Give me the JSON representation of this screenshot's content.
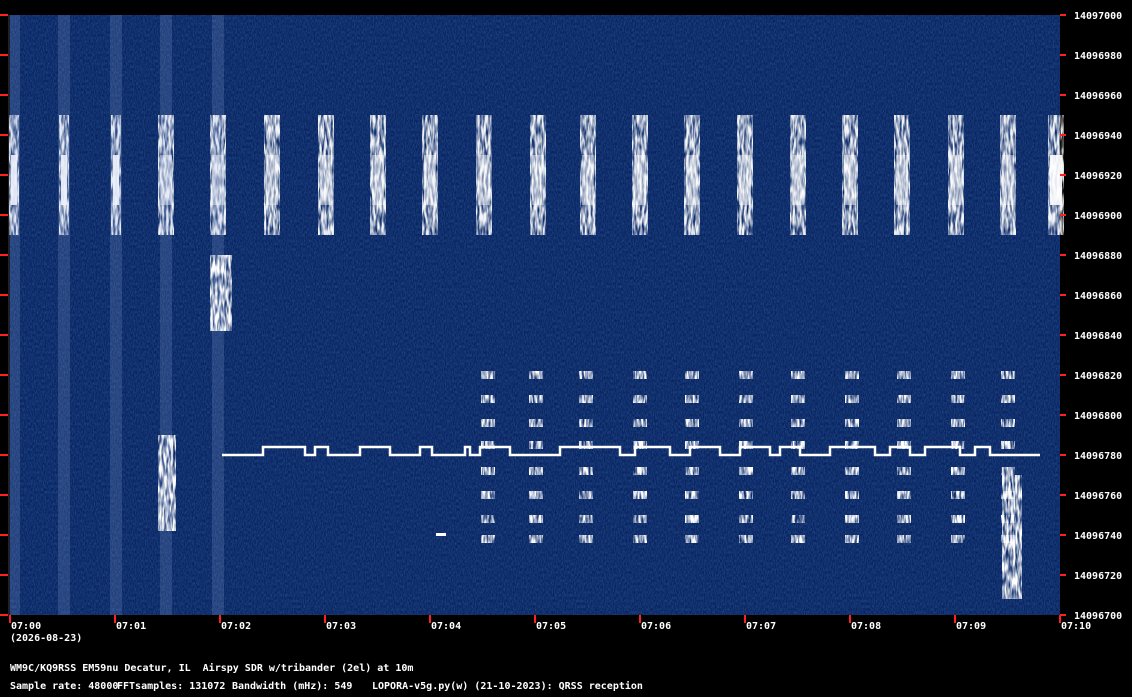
{
  "chart_data": {
    "type": "heatmap",
    "title": "WM9C/KQ9RSS EM59nu Decatur, IL  Airspy SDR w/tribander (2el) at 10m",
    "date": "(2026-08-23)",
    "x_tick_labels": [
      "07:00",
      "07:01",
      "07:02",
      "07:03",
      "07:04",
      "07:05",
      "07:06",
      "07:07",
      "07:08",
      "07:09",
      "07:10"
    ],
    "y_tick_labels": [
      "14097000",
      "14096980",
      "14096960",
      "14096940",
      "14096920",
      "14096900",
      "14096880",
      "14096860",
      "14096840",
      "14096820",
      "14096800",
      "14096780",
      "14096760",
      "14096740",
      "14096720",
      "14096700"
    ],
    "ylim": [
      14096700,
      14097000
    ],
    "xlim": [
      "07:00",
      "07:10"
    ],
    "colors": {
      "background": "#0a1f5c",
      "signal": "#ffffff",
      "tick": "#ff2020",
      "text": "#ffffff"
    },
    "signals": [
      {
        "name": "",
        "freq": 14096920,
        "kind": "dashed-carrier"
      },
      {
        "name": "",
        "freq": 14096780,
        "kind": "fsk-trace"
      },
      {
        "name": "",
        "freq": 14096800,
        "kind": "multi-tone"
      }
    ]
  },
  "footer": {
    "line1": "WM9C/KQ9RSS EM59nu Decatur, IL  Airspy SDR w/tribander (2el) at 10m",
    "sample_rate": "Sample rate: 48000",
    "fft_samples": "FFTsamples: 131072",
    "bandwidth": "Bandwidth (mHz): 549",
    "software": "LOPORA-v5g.py(w) (21-10-2023): QRSS reception"
  }
}
